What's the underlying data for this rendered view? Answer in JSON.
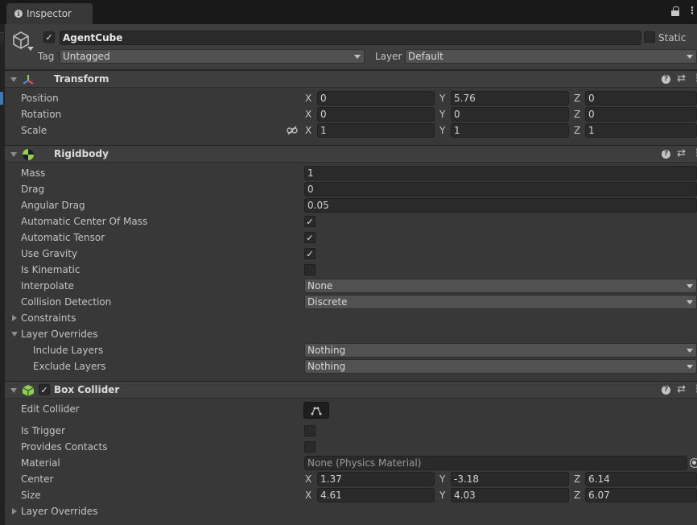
{
  "window": {
    "tab_title": "Inspector"
  },
  "header": {
    "name": "AgentCube",
    "static_label": "Static",
    "tag_label": "Tag",
    "tag_value": "Untagged",
    "layer_label": "Layer",
    "layer_value": "Default"
  },
  "transform": {
    "title": "Transform",
    "rows": [
      {
        "label": "Position",
        "x": "0",
        "y": "5.76",
        "z": "0"
      },
      {
        "label": "Rotation",
        "x": "0",
        "y": "0",
        "z": "0"
      },
      {
        "label": "Scale",
        "x": "1",
        "y": "1",
        "z": "1"
      }
    ]
  },
  "axes": {
    "x": "X",
    "y": "Y",
    "z": "Z"
  },
  "rigidbody": {
    "title": "Rigidbody",
    "mass_label": "Mass",
    "mass": "1",
    "drag_label": "Drag",
    "drag": "0",
    "angular_drag_label": "Angular Drag",
    "angular_drag": "0.05",
    "auto_com_label": "Automatic Center Of Mass",
    "auto_com": true,
    "auto_tensor_label": "Automatic Tensor",
    "auto_tensor": true,
    "use_gravity_label": "Use Gravity",
    "use_gravity": true,
    "is_kinematic_label": "Is Kinematic",
    "is_kinematic": false,
    "interpolate_label": "Interpolate",
    "interpolate": "None",
    "collision_label": "Collision Detection",
    "collision": "Discrete",
    "constraints_label": "Constraints",
    "layer_overrides_label": "Layer Overrides",
    "include_label": "Include Layers",
    "include": "Nothing",
    "exclude_label": "Exclude Layers",
    "exclude": "Nothing"
  },
  "box_collider": {
    "title": "Box Collider",
    "enabled": true,
    "edit_label": "Edit Collider",
    "is_trigger_label": "Is Trigger",
    "is_trigger": false,
    "provides_contacts_label": "Provides Contacts",
    "provides_contacts": false,
    "material_label": "Material",
    "material": "None (Physics Material)",
    "center_label": "Center",
    "center": {
      "x": "1.37",
      "y": "-3.18",
      "z": "6.14"
    },
    "size_label": "Size",
    "size": {
      "x": "4.61",
      "y": "4.03",
      "z": "6.07"
    },
    "layer_overrides_label": "Layer Overrides"
  },
  "glyphs": {
    "check": "✓",
    "help": "?",
    "preset": "⇄",
    "kebab": "⋮"
  },
  "icons": [
    "info-icon",
    "lock-icon",
    "kebab-icon",
    "gameobject-cube-icon",
    "transform-axes-icon",
    "rigidbody-icon",
    "box-collider-icon",
    "help-icon",
    "preset-icon",
    "link-scale-icon",
    "edit-collider-icon",
    "object-picker-icon"
  ],
  "colors": {
    "panel": "#383838",
    "header": "#3e3e3e",
    "field": "#2a2a2a",
    "dropdown": "#515151",
    "accent": "#3a79bb",
    "collider_green": "#8fd14f"
  }
}
